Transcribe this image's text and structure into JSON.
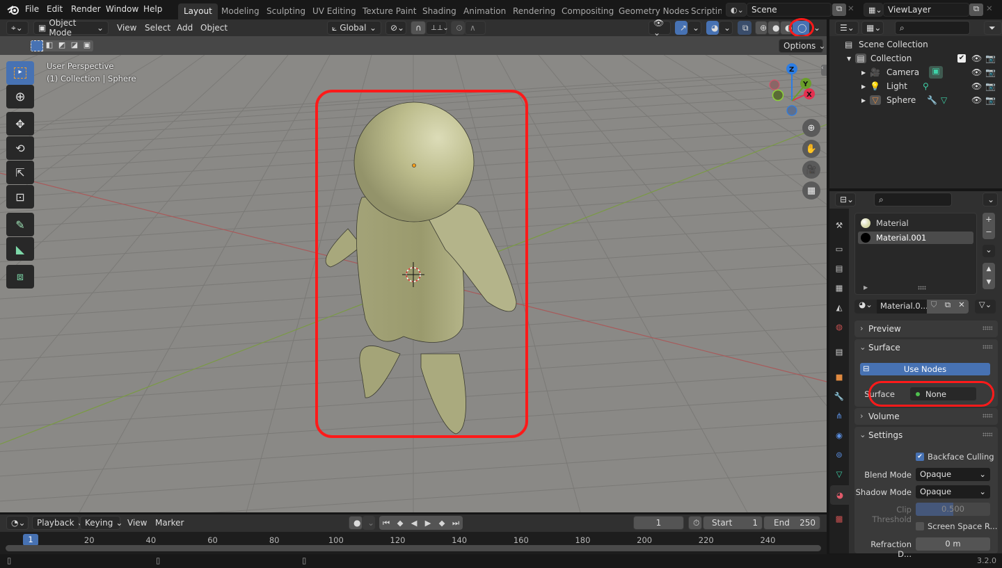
{
  "app": {
    "version": "3.2.0"
  },
  "menu": [
    "File",
    "Edit",
    "Render",
    "Window",
    "Help"
  ],
  "workspaces": [
    {
      "label": "Layout",
      "active": true
    },
    {
      "label": "Modeling"
    },
    {
      "label": "Sculpting"
    },
    {
      "label": "UV Editing"
    },
    {
      "label": "Texture Paint"
    },
    {
      "label": "Shading"
    },
    {
      "label": "Animation"
    },
    {
      "label": "Rendering"
    },
    {
      "label": "Compositing"
    },
    {
      "label": "Geometry Nodes"
    },
    {
      "label": "Scripting"
    }
  ],
  "scene": {
    "name": "Scene",
    "view_layer": "ViewLayer"
  },
  "viewport_header": {
    "mode": "Object Mode",
    "menus": [
      "View",
      "Select",
      "Add",
      "Object"
    ],
    "transform_orientation": "Global",
    "shading_mode_active": "rendered",
    "options_label": "Options"
  },
  "viewport": {
    "perspective_label": "User Perspective",
    "context_label": "(1) Collection | Sphere",
    "gizmo_axes": [
      "X",
      "Y",
      "Z"
    ],
    "tools": [
      "select-box",
      "cursor",
      "move",
      "rotate",
      "scale",
      "transform",
      "annotate",
      "measure",
      "add-cube"
    ],
    "nav_buttons": [
      "zoom",
      "pan",
      "camera",
      "ortho-toggle"
    ]
  },
  "outliner": {
    "root": "Scene Collection",
    "collection": "Collection",
    "items": [
      {
        "name": "Camera",
        "type": "camera"
      },
      {
        "name": "Light",
        "type": "light"
      },
      {
        "name": "Sphere",
        "type": "mesh"
      }
    ]
  },
  "properties": {
    "material_slots": [
      {
        "name": "Material",
        "color": "#d6d8a8",
        "selected": false
      },
      {
        "name": "Material.001",
        "color": "#000000",
        "selected": true
      }
    ],
    "material_name": "Material.0...",
    "panels": {
      "preview": "Preview",
      "surface": "Surface",
      "use_nodes": "Use Nodes",
      "surface_label": "Surface",
      "surface_value": "None",
      "volume": "Volume",
      "settings": "Settings"
    },
    "settings": {
      "backface_culling_label": "Backface Culling",
      "backface_culling": true,
      "blend_mode_label": "Blend Mode",
      "blend_mode": "Opaque",
      "shadow_mode_label": "Shadow Mode",
      "shadow_mode": "Opaque",
      "clip_threshold_label": "Clip Threshold",
      "clip_threshold": "0.500",
      "clip_threshold_fraction": 0.5,
      "ssr_label": "Screen Space R...",
      "ssr": false,
      "refraction_label": "Refraction D...",
      "refraction_value": "0 m"
    }
  },
  "timeline": {
    "menus": [
      "Playback",
      "Keying",
      "View",
      "Marker"
    ],
    "current_frame": "1",
    "start_label": "Start",
    "start": "1",
    "end_label": "End",
    "end": "250",
    "ticks": [
      "20",
      "40",
      "60",
      "80",
      "100",
      "120",
      "140",
      "160",
      "180",
      "200",
      "220",
      "240"
    ],
    "playhead": "1"
  },
  "colors": {
    "accent": "#4772b3",
    "highlight_ring": "#ff1a1a",
    "object_color": "#b5b58a"
  }
}
